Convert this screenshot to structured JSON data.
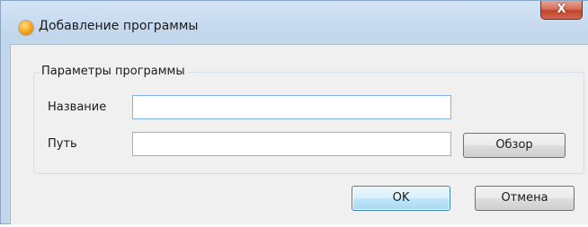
{
  "window": {
    "title": "Добавление программы",
    "icon": "app-orb-icon",
    "close_glyph": "X"
  },
  "group": {
    "legend": "Параметры программы"
  },
  "fields": {
    "name": {
      "label": "Название",
      "value": "",
      "placeholder": ""
    },
    "path": {
      "label": "Путь",
      "value": "",
      "placeholder": ""
    }
  },
  "buttons": {
    "browse": "Обзор",
    "ok": "OK",
    "cancel": "Отмена"
  },
  "colors": {
    "title_bar": "#c2d6ec",
    "client": "#f0f0f0",
    "close_button": "#c2442b",
    "focus_border": "#7eb4ea",
    "default_button_border": "#3c7fb1"
  }
}
